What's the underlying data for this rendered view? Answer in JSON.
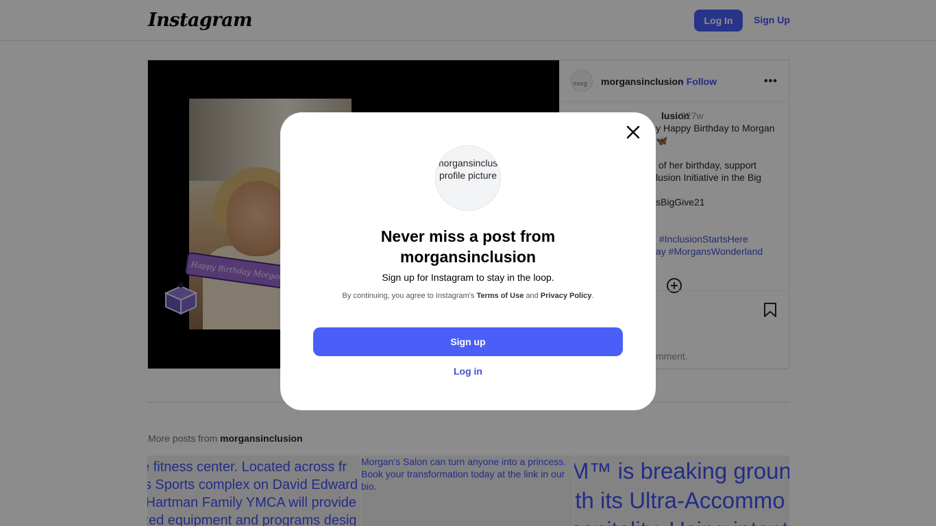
{
  "header": {
    "logo": "Instagram",
    "login_label": "Log In",
    "signup_label": "Sign Up"
  },
  "post": {
    "banner_text": "Happy Birthday Morgan",
    "username": "morgansinclusion",
    "follow_label": "• Follow",
    "more_label": "•••",
    "caption_user_partial": "lusion",
    "time": "227w",
    "caption_lines": [
      "y Happy Birthday to Morgan",
      "🦋",
      "of her birthday, support",
      "lusion Initiative in the Big",
      "sBigGive21"
    ],
    "hashtag_lines": [
      "#InclusionStartsHere",
      "ay #MorgansWonderland"
    ],
    "comment_hint": "mment."
  },
  "more_posts": {
    "prefix": "More posts from ",
    "username": "morgansinclusion",
    "tiles": [
      "e fitness center. Located across fr\n's Sports complex on David Edward\n Hartman Family YMCA will provide\nzed equipment and programs desig",
      "Morgan's Salon can turn anyone into a princess. Book your transformation today at the link in our bio.",
      "M™ is breaking ground a\nith its Ultra-Accommo\nospitality. Using intent"
    ]
  },
  "modal": {
    "avatar_alt": "morgansinclusion's profile picture",
    "title_line1": "Never miss a post from",
    "title_line2": "morgansinclusion",
    "subtitle": "Sign up for Instagram to stay in the loop.",
    "legal_prefix": "By continuing, you agree to Instagram's ",
    "terms": "Terms of Use",
    "and": " and ",
    "privacy": "Privacy Policy",
    "legal_suffix": ".",
    "signup_label": "Sign up",
    "login_label": "Log in"
  }
}
